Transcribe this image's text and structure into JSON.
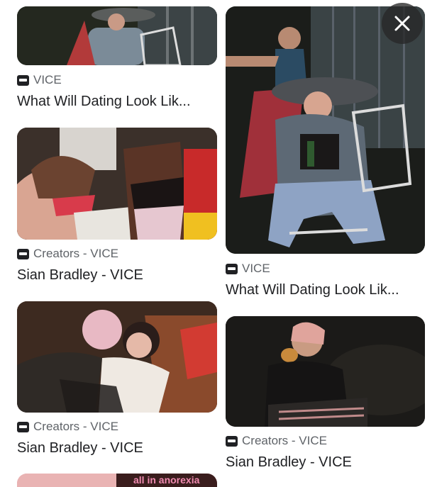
{
  "close_icon": "close-icon",
  "results": [
    {
      "source": "VICE",
      "title": "What Will Dating Look Lik..."
    },
    {
      "source": "VICE",
      "title": "What Will Dating Look Lik..."
    },
    {
      "source": "Creators - VICE",
      "title": "Sian Bradley - VICE"
    },
    {
      "source": "Creators - VICE",
      "title": "Sian Bradley - VICE"
    },
    {
      "source": "Creators - VICE",
      "title": "Sian Bradley - VICE"
    },
    {
      "partial_banner_text": "all in anorexia"
    }
  ],
  "colors": {
    "source_text": "#5f6368",
    "title_text": "#202124",
    "favicon": "#202124"
  }
}
